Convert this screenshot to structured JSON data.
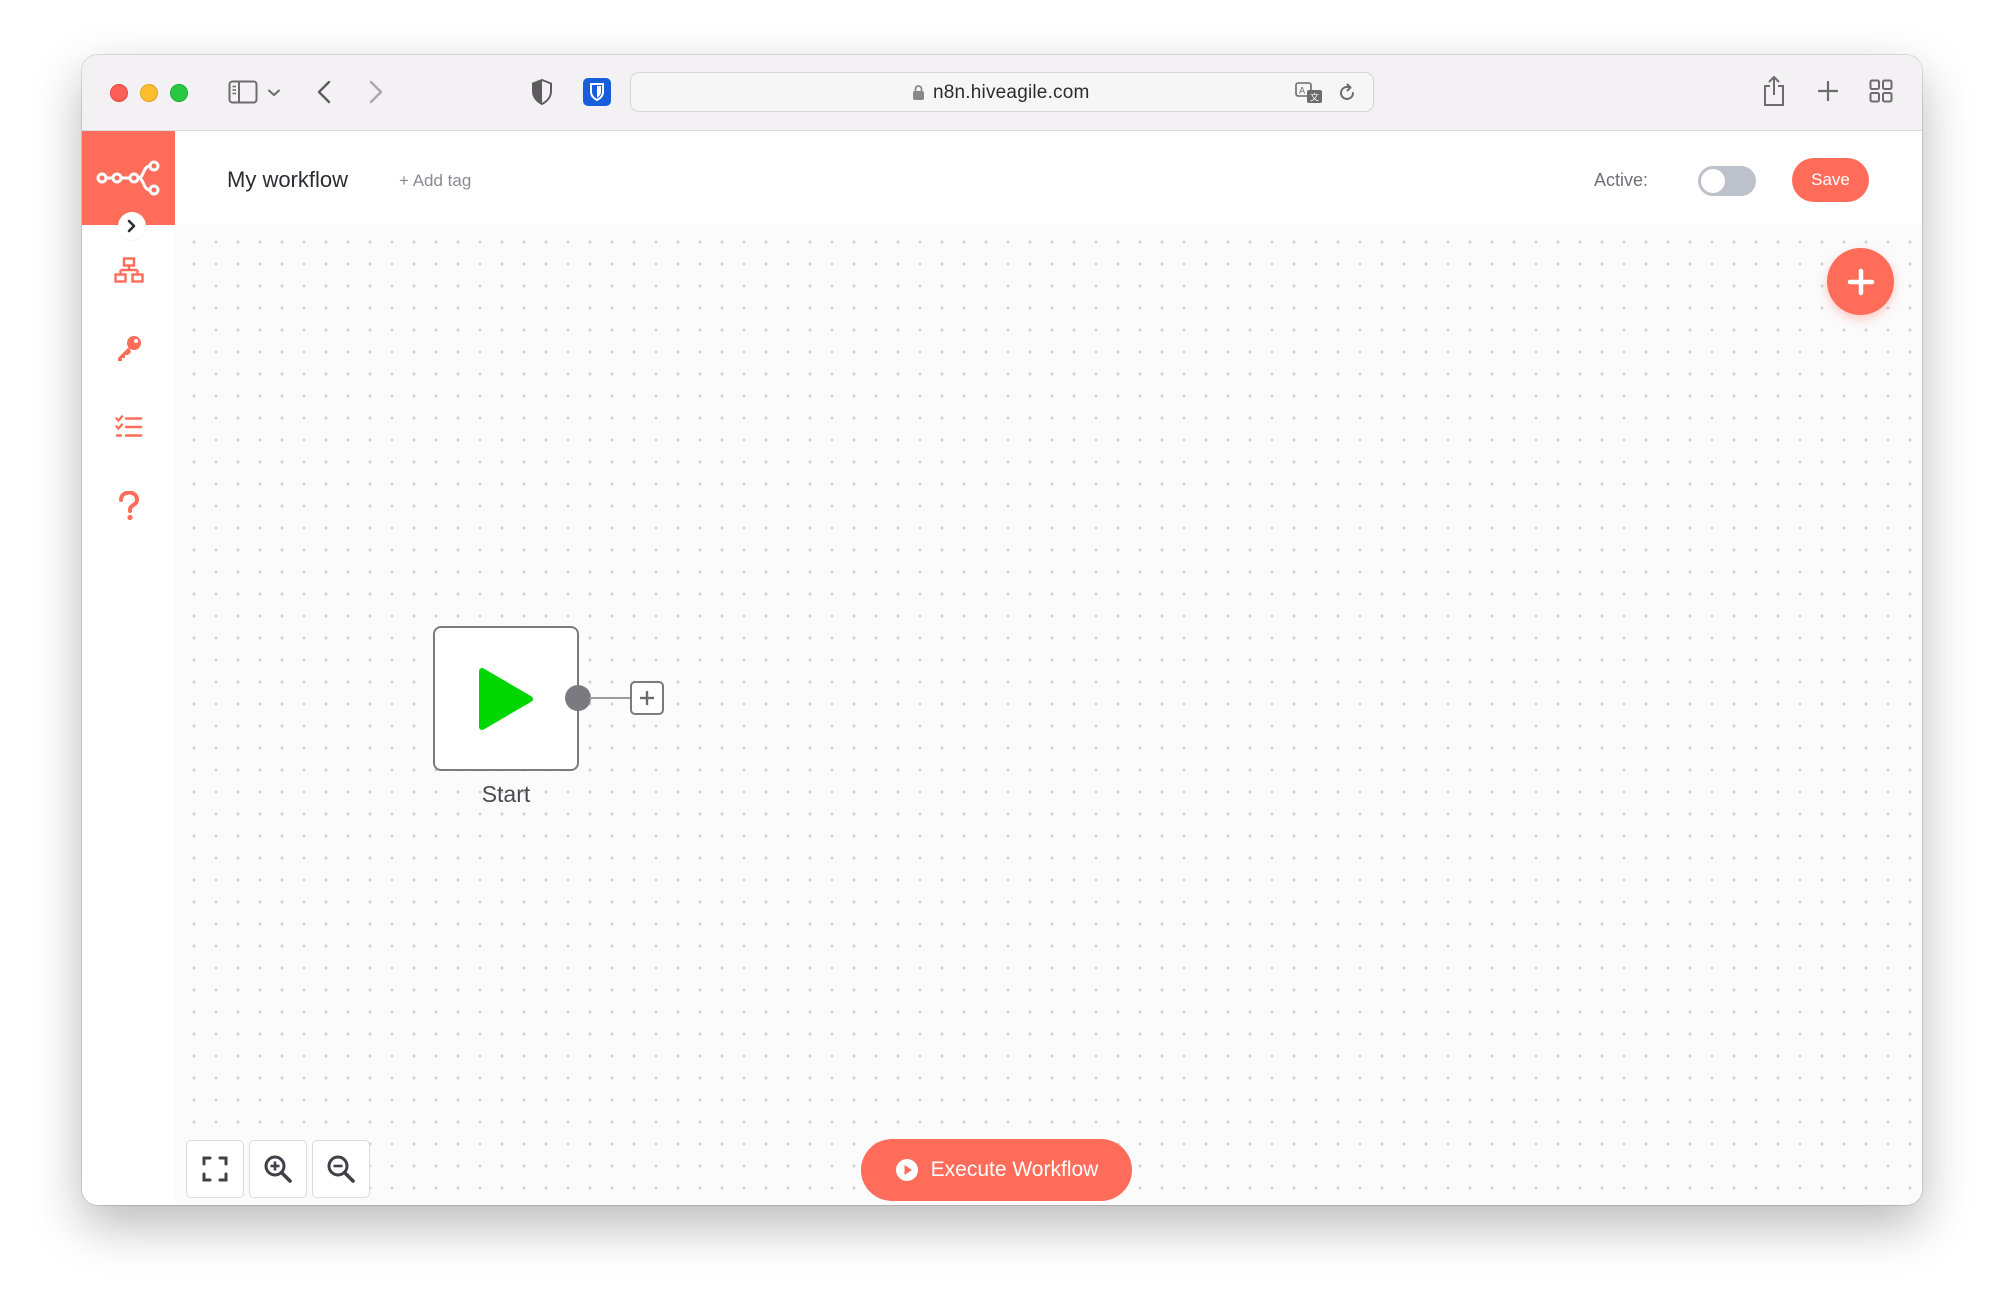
{
  "browser": {
    "url": "n8n.hiveagile.com"
  },
  "header": {
    "workflow_title": "My workflow",
    "add_tag_label": "+ Add tag",
    "active_label": "Active:",
    "active_state": false,
    "save_label": "Save"
  },
  "sidebar": {
    "items": [
      {
        "name": "workflows",
        "icon": "network-icon"
      },
      {
        "name": "credentials",
        "icon": "key-icon"
      },
      {
        "name": "executions",
        "icon": "tasks-icon"
      },
      {
        "name": "help",
        "icon": "question-icon"
      }
    ]
  },
  "canvas": {
    "nodes": [
      {
        "label": "Start",
        "icon": "play-icon"
      }
    ],
    "execute_label": "Execute Workflow"
  },
  "colors": {
    "brand": "#ff6d5a",
    "start_node_icon": "#00d600",
    "toggle_off": "#bcc1cb"
  }
}
